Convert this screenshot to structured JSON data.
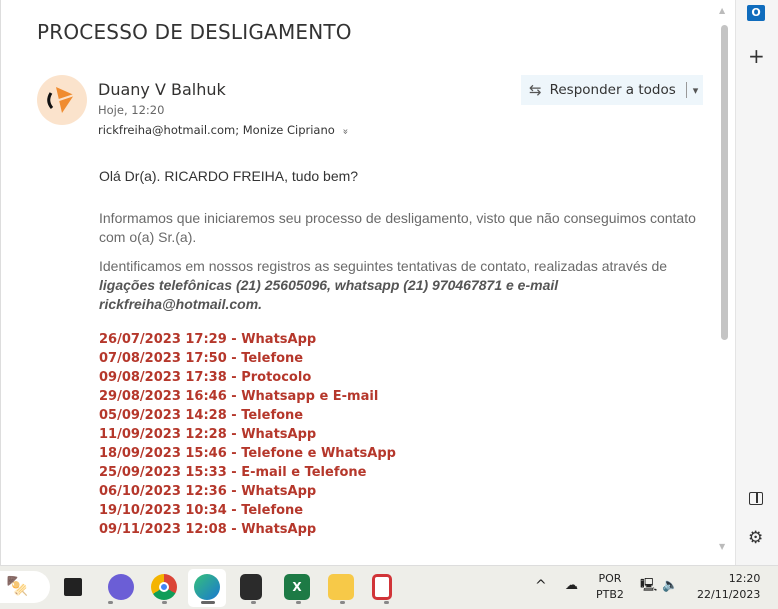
{
  "email": {
    "subject": "PROCESSO DE DESLIGAMENTO",
    "sender": "Duany V Balhuk",
    "date": "Hoje, 12:20",
    "recipients": "rickfreiha@hotmail.com; Monize Cipriano",
    "expand_icon": "»",
    "reply_all_label": "Responder a todos"
  },
  "body": {
    "greeting": "Olá Dr(a). RICARDO FREIHA, tudo bem?",
    "para1": "Informamos que iniciaremos seu processo de desligamento, visto que não conseguimos contato com o(a) Sr.(a).",
    "para2_prefix": "Identificamos em nossos registros as seguintes tentativas de contato, realizadas através de ",
    "para2_bold": "ligações telefônicas (21) 25605096, whatsapp (21) 970467871 e e-mail rickfreiha@hotmail.com.",
    "attempts": [
      "26/07/2023 17:29 - WhatsApp",
      "07/08/2023 17:50 - Telefone",
      "09/08/2023 17:38 - Protocolo",
      "29/08/2023 16:46 - Whatsapp e E-mail",
      "05/09/2023 14:28 - Telefone",
      "11/09/2023 12:28 - WhatsApp",
      "18/09/2023 15:46 - Telefone e WhatsApp",
      "25/09/2023 15:33 - E-mail e Telefone",
      "06/10/2023 12:36 - WhatsApp",
      "19/10/2023 10:34 - Telefone",
      "09/11/2023 12:08 - WhatsApp"
    ]
  },
  "rail": {
    "outlook_icon": "O",
    "add_icon": "+"
  },
  "taskbar": {
    "lang": "POR",
    "layout": "PTB2",
    "time": "12:20",
    "date": "22/11/2023",
    "chevron": "^"
  },
  "colors": {
    "accent_red": "#b5372b",
    "reply_bg": "#eef6fb"
  }
}
